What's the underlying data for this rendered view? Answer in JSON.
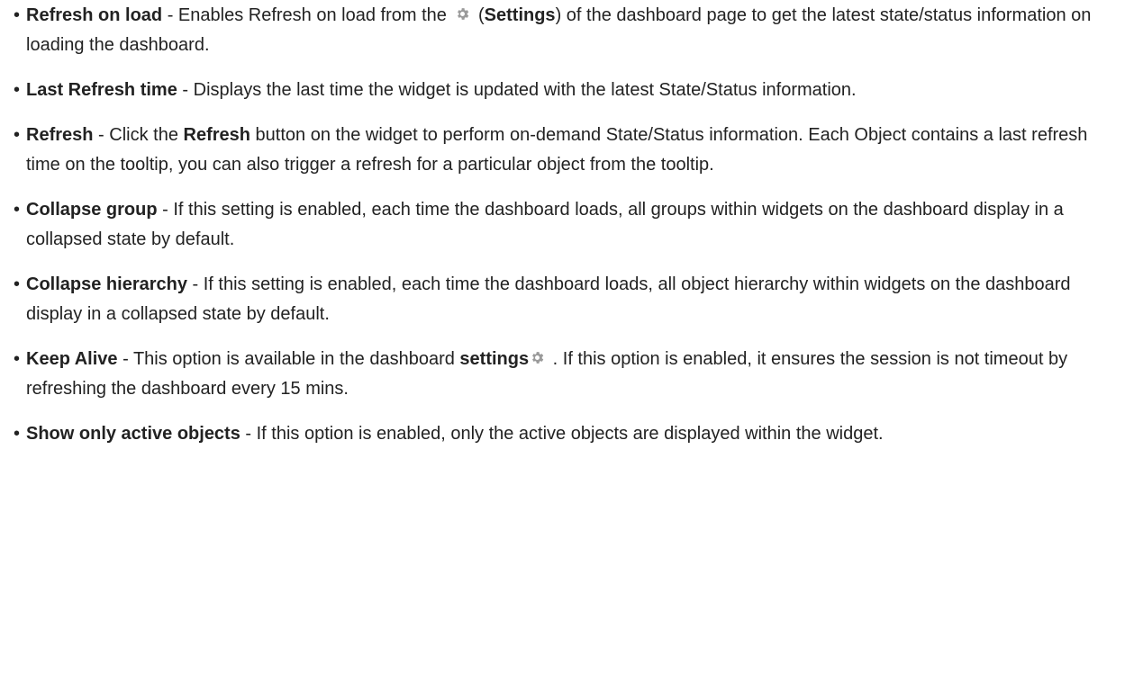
{
  "bullet": "•",
  "gear_color": "#9a9a9a",
  "items": [
    {
      "term": "Refresh on load",
      "sep": " - ",
      "text_a": "Enables Refresh on load from the ",
      "icon": "gear-icon",
      "paren_open": " (",
      "bold_b": "Settings",
      "text_b": ") of the dashboard page to get the latest state/status information on loading the dashboard."
    },
    {
      "term": "Last Refresh time",
      "sep": " - ",
      "text": "Displays the last time the widget is updated with the latest State/Status information."
    },
    {
      "term": "Refresh",
      "sep": " - ",
      "text_a": "Click the ",
      "bold_b": "Refresh",
      "text_b": " button on the widget to perform on-demand State/Status information. Each Object contains a last refresh time on the tooltip, you can also trigger a refresh for a particular object from the tooltip."
    },
    {
      "term": "Collapse group",
      "sep": " - ",
      "text": "If this setting is enabled, each time the dashboard loads, all groups within widgets on the dashboard display in a collapsed state by default."
    },
    {
      "term": "Collapse hierarchy",
      "sep": " - ",
      "text": "If this setting is enabled, each time the dashboard loads, all object hierarchy within widgets on the dashboard display in a collapsed state by default."
    },
    {
      "term": "Keep Alive",
      "sep": " - ",
      "text_a": "This option is available in the dashboard ",
      "bold_b": "settings",
      "icon": "gear-icon",
      "text_b": " . If this option is enabled, it ensures the session is not timeout by refreshing the dashboard every 15 mins."
    },
    {
      "term": "Show only active objects",
      "sep": " - ",
      "text": "If this option is enabled, only the active objects are displayed within the widget."
    }
  ]
}
